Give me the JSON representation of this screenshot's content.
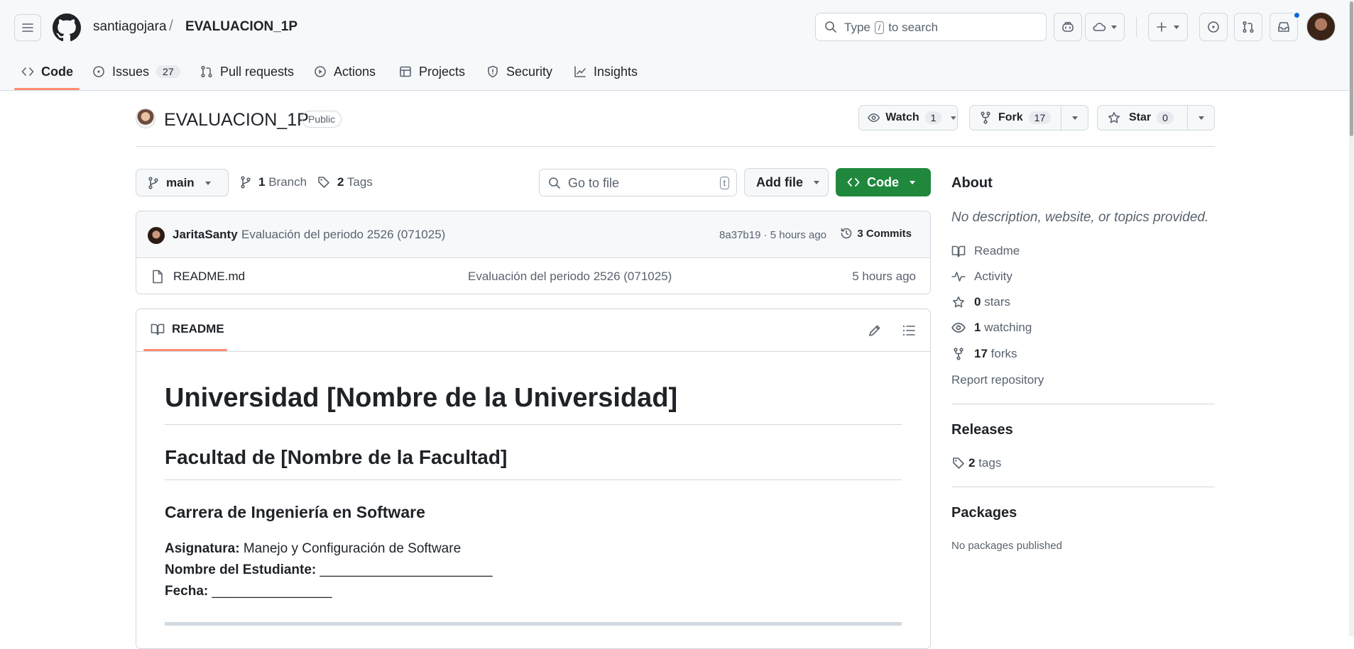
{
  "header": {
    "owner": "santiagojara",
    "separator": "/",
    "repo": "EVALUACION_1P",
    "search": {
      "prefix": "Type",
      "key": "/",
      "suffix": "to search"
    }
  },
  "tabs": [
    {
      "label": "Code",
      "icon": "code-icon",
      "selected": true
    },
    {
      "label": "Issues",
      "count": "27",
      "icon": "issue-icon"
    },
    {
      "label": "Pull requests",
      "icon": "pull-request-icon"
    },
    {
      "label": "Actions",
      "icon": "play-icon"
    },
    {
      "label": "Projects",
      "icon": "table-icon"
    },
    {
      "label": "Security",
      "icon": "shield-icon"
    },
    {
      "label": "Insights",
      "icon": "graph-icon"
    }
  ],
  "repo": {
    "title": "EVALUACION_1P",
    "visibility": "Public",
    "watch": {
      "label": "Watch",
      "count": "1"
    },
    "fork": {
      "label": "Fork",
      "count": "17"
    },
    "star": {
      "label": "Star",
      "count": "0"
    }
  },
  "toolbar": {
    "branch": "main",
    "branches_count": "1",
    "branches_label": "Branch",
    "tags_count": "2",
    "tags_label": "Tags",
    "go_to_file": "Go to file",
    "go_to_file_key": "t",
    "add_file": "Add file",
    "code": "Code"
  },
  "latest_commit": {
    "author": "JaritaSanty",
    "message": "Evaluación del periodo 2526 (071025)",
    "hash_time": "8a37b19 · 5 hours ago",
    "commits": "3 Commits"
  },
  "files": [
    {
      "name": "README.md",
      "message": "Evaluación del periodo 2526 (071025)",
      "time": "5 hours ago"
    }
  ],
  "readme": {
    "tab": "README",
    "h1": "Universidad [Nombre de la Universidad]",
    "h2": "Facultad de [Nombre de la Facultad]",
    "h3": "Carrera de Ingeniería en Software",
    "lines": [
      {
        "label": "Asignatura:",
        "value": "Manejo y Configuración de Software"
      },
      {
        "label": "Nombre del Estudiante:",
        "value": "_______________________"
      },
      {
        "label": "Fecha:",
        "value": "________________"
      }
    ]
  },
  "about": {
    "title": "About",
    "description": "No description, website, or topics provided.",
    "readme": "Readme",
    "activity": "Activity",
    "stars_count": "0",
    "stars_label": "stars",
    "watching_count": "1",
    "watching_label": "watching",
    "forks_count": "17",
    "forks_label": "forks",
    "report": "Report repository"
  },
  "releases": {
    "title": "Releases",
    "tags_count": "2",
    "tags_label": "tags"
  },
  "packages": {
    "title": "Packages",
    "empty": "No packages published"
  },
  "colors": {
    "accent_green": "#1f883d",
    "tab_underline": "#fd8c73",
    "notification_dot": "#0969da"
  }
}
